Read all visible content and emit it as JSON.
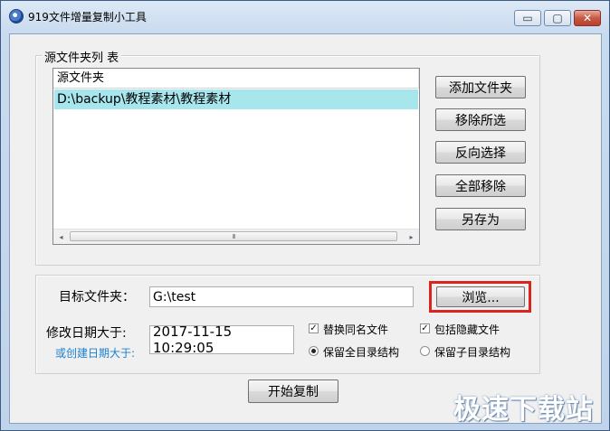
{
  "window": {
    "title": "919文件增量复制小工具",
    "minimize_glyph": "▭",
    "maximize_glyph": "▢",
    "close_glyph": "✕"
  },
  "source_group": {
    "legend": "源文件夹列 表",
    "list_header": "源文件夹",
    "items": [
      "D:\\backup\\教程素材\\教程素材"
    ],
    "scrollbar": {
      "left_arrow": "◂",
      "thumb_grip": "III",
      "right_arrow": "▸"
    }
  },
  "side_buttons": {
    "add_folder": "添加文件夹",
    "remove_selected": "移除所选",
    "invert_selection": "反向选择",
    "remove_all": "全部移除",
    "save_as": "另存为"
  },
  "target_group": {
    "target_label": "目标文件夹：",
    "target_value": "G:\\test",
    "browse_label": "浏览...",
    "modified_label": "修改日期大于:",
    "created_label": "或创建日期大于:",
    "date_value": "2017-11-15 10:29:05",
    "options": {
      "replace_same_name": {
        "label": "替换同名文件",
        "checked": true
      },
      "include_hidden": {
        "label": "包括隐藏文件",
        "checked": true
      },
      "keep_full_structure": {
        "label": "保留全目录结构",
        "selected": true
      },
      "keep_sub_structure": {
        "label": "保留子目录结构",
        "selected": false
      }
    }
  },
  "start_button": "开始复制",
  "watermark": "极速下载站"
}
